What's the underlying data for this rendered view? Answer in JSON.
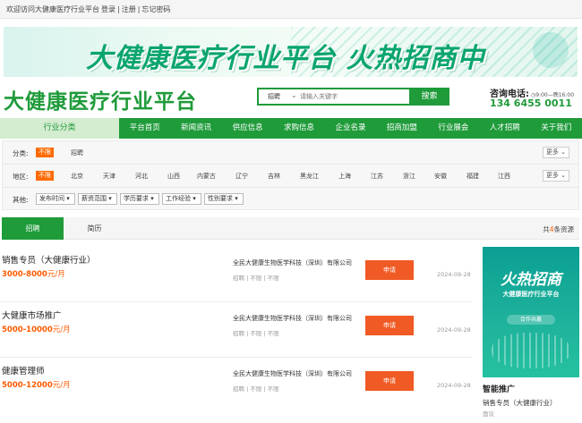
{
  "topbar": {
    "welcome": "欢迎访问大健康医疗行业平台",
    "login": "登录",
    "sep1": "|",
    "register": "注册",
    "sep2": "|",
    "forgot": "忘记密码"
  },
  "banner": {
    "text": "大健康医疗行业平台  火热招商中"
  },
  "header": {
    "logo": "大健康医疗行业平台",
    "search_type": "招聘",
    "search_placeholder": "请输入关键字",
    "search_button": "搜索",
    "hotline_label": "咨询电话:",
    "hotline_hours": "9:00—晚16:00",
    "phone": "134 6455 0011"
  },
  "nav": {
    "category": "行业分类",
    "items": [
      "平台首页",
      "新闻资讯",
      "供应信息",
      "求购信息",
      "企业名录",
      "招商加盟",
      "行业展会",
      "人才招聘",
      "关于我们"
    ]
  },
  "filters": {
    "category_label": "分类:",
    "category_selected": "不限",
    "category_options": [
      "招聘"
    ],
    "region_label": "地区:",
    "region_selected": "不限",
    "region_options": [
      "北京",
      "天津",
      "河北",
      "山西",
      "内蒙古",
      "辽宁",
      "吉林",
      "黑龙江",
      "上海",
      "江苏",
      "浙江",
      "安徽",
      "福建",
      "江西"
    ],
    "more_label": "更多",
    "other_label": "其他:",
    "dropdowns": [
      "发布时间",
      "薪资范围",
      "学历要求",
      "工作经验",
      "性别要求"
    ]
  },
  "tabs": {
    "recruit": "招聘",
    "resume": "简历",
    "total_prefix": "共",
    "total_count": "4",
    "total_suffix": "条资源"
  },
  "jobs": [
    {
      "title": "销售专员（大健康行业）",
      "salary": "3000-8000",
      "unit": "元/月",
      "company": "全民大健康生物医学科技（深圳）有限公司",
      "meta": "招聘 | 不限 | 不限",
      "apply": "申请",
      "date": "2024-09-28"
    },
    {
      "title": "大健康市场推广",
      "salary": "5000-10000",
      "unit": "元/月",
      "company": "全民大健康生物医学科技（深圳）有限公司",
      "meta": "招聘 | 不限 | 不限",
      "apply": "申请",
      "date": "2024-09-28"
    },
    {
      "title": "健康管理师",
      "salary": "5000-12000",
      "unit": "元/月",
      "company": "全民大健康生物医学科技（深圳）有限公司",
      "meta": "招聘 | 不限 | 不限",
      "apply": "申请",
      "date": "2024-09-28"
    }
  ],
  "sidebar": {
    "ad_title": "火热招商",
    "ad_subtitle": "大健康医疗行业平台",
    "ad_pill": "合作共赢",
    "section_title": "智能推广",
    "item": "销售专员（大健康行业）",
    "item_salary": "面议"
  },
  "colors": {
    "brand_green": "#1f9b3a",
    "accent_orange": "#ff5a00",
    "apply_button": "#f05a24"
  }
}
